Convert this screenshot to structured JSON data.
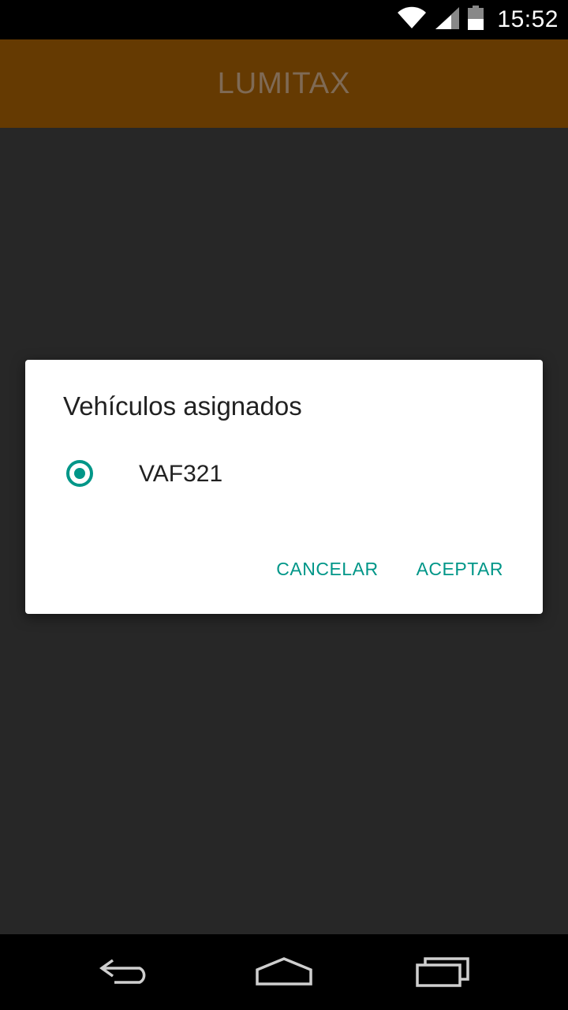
{
  "status_bar": {
    "time": "15:52",
    "icons": [
      "wifi-icon",
      "signal-icon",
      "battery-icon"
    ]
  },
  "app_bar": {
    "title": "LUMITAX"
  },
  "dialog": {
    "title": "Vehículos asignados",
    "options": [
      {
        "label": "VAF321",
        "selected": true
      }
    ],
    "cancel_label": "CANCELAR",
    "accept_label": "ACEPTAR"
  },
  "nav_bar": {
    "icons": [
      "back-icon",
      "home-icon",
      "recents-icon"
    ]
  },
  "colors": {
    "app_bar": "#653a02",
    "accent": "#009688",
    "scrim_background": "#272727"
  }
}
